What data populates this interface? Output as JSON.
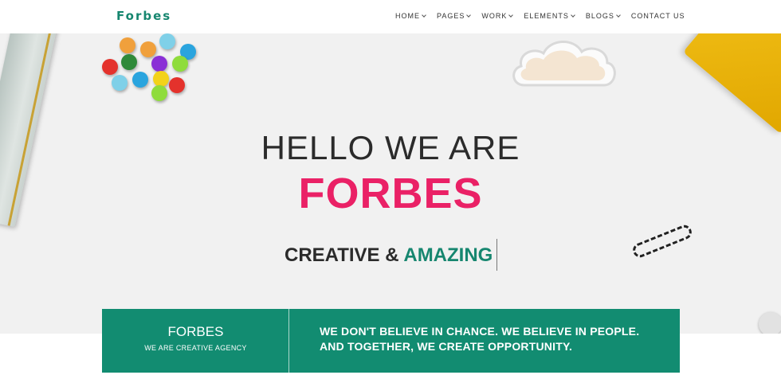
{
  "navbar": {
    "brand": "Forbes",
    "items": [
      {
        "label": "HOME",
        "dropdown": true
      },
      {
        "label": "PAGES",
        "dropdown": true
      },
      {
        "label": "WORK",
        "dropdown": true
      },
      {
        "label": "ELEMENTS",
        "dropdown": true
      },
      {
        "label": "BLOGS",
        "dropdown": true
      },
      {
        "label": "CONTACT US",
        "dropdown": false
      }
    ]
  },
  "hero": {
    "title": "HELLO WE ARE",
    "brand": "FORBES",
    "tagline_start": "CREATIVE &",
    "tagline_accent": "AMAZING"
  },
  "banner": {
    "title": "FORBES",
    "subtitle": "WE ARE CREATIVE AGENCY",
    "text": "WE DON'T BELIEVE IN CHANCE. WE BELIEVE IN PEOPLE. AND TOGETHER, WE CREATE OPPORTUNITY."
  },
  "colors": {
    "accent": "#16866f",
    "brand_pink": "#ea2166",
    "banner_bg": "#128c71",
    "hero_bg": "#f1f1f1"
  },
  "icons": [
    "chevron-down-icon"
  ]
}
